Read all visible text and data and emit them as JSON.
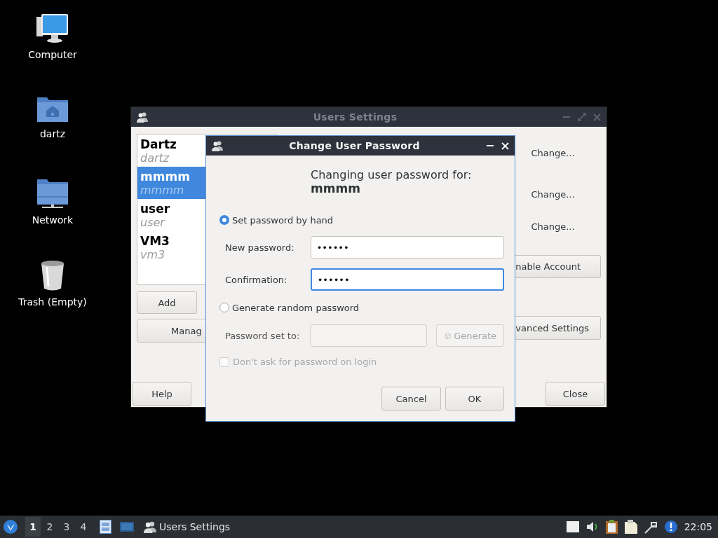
{
  "desktop_icons": [
    {
      "label": "Computer",
      "kind": "computer"
    },
    {
      "label": "dartz",
      "kind": "home"
    },
    {
      "label": "Network",
      "kind": "network"
    },
    {
      "label": "Trash (Empty)",
      "kind": "trash"
    }
  ],
  "users_window": {
    "title": "Users Settings",
    "active": false,
    "users": [
      {
        "name": "Dartz",
        "login": "dartz",
        "selected": false
      },
      {
        "name": "mmmm",
        "login": "mmmm",
        "selected": true
      },
      {
        "name": "user",
        "login": "user",
        "selected": false
      },
      {
        "name": "VM3",
        "login": "vm3",
        "selected": false
      }
    ],
    "list_buttons": [
      "Add",
      "Manag"
    ],
    "change_buttons": [
      "Change...",
      "Change...",
      "Change..."
    ],
    "account_buttons": [
      "nable Account",
      "vanced Settings"
    ],
    "footer_buttons": [
      "Help",
      "Close"
    ]
  },
  "password_dialog": {
    "title": "Change User Password",
    "active": true,
    "heading": "Changing user password for:",
    "username": "mmmm",
    "modes": [
      {
        "label": "Set password by hand",
        "selected": true
      },
      {
        "label": "Generate random password",
        "selected": false
      }
    ],
    "fields": [
      {
        "label": "New password:",
        "value": "••••••",
        "focused": false
      },
      {
        "label": "Confirmation:",
        "value": "••••••",
        "focused": true
      }
    ],
    "generated": {
      "label": "Password set to:",
      "disabled": true,
      "button": "Generate"
    },
    "no_password": {
      "label": "Don't ask for password on login",
      "checked": false,
      "disabled": true
    },
    "buttons": [
      "Cancel",
      "OK"
    ]
  },
  "taskbar": {
    "workspaces": [
      {
        "label": "1",
        "selected": true
      },
      {
        "label": "2",
        "selected": false
      },
      {
        "label": "3",
        "selected": false
      },
      {
        "label": "4",
        "selected": false
      }
    ],
    "tasks": [
      {
        "label": "Users Settings"
      }
    ],
    "clock": "22:05"
  }
}
